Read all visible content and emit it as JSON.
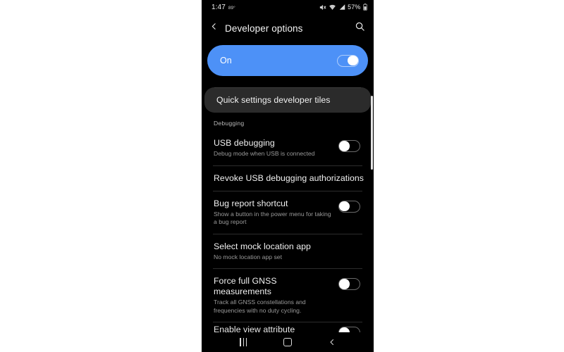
{
  "status_bar": {
    "time": "1:47",
    "temperature": "89°",
    "battery_percent": "57%",
    "icons": [
      "mute-icon",
      "wifi-icon",
      "signal-icon",
      "battery-icon"
    ]
  },
  "action_bar": {
    "back_icon": "back-chevron-icon",
    "title": "Developer options",
    "search_icon": "search-icon"
  },
  "master_switch": {
    "label": "On",
    "state": "on"
  },
  "colors": {
    "accent": "#4d91f7",
    "screen_background": "#000000",
    "highlight_card": "#2b2b2b",
    "primary_text": "#f1f1f1",
    "secondary_text": "#9a9a9a",
    "page_background": "#ffffff"
  },
  "list": {
    "highlighted_item": {
      "title": "Quick settings developer tiles",
      "subtitle": "",
      "toggle": null
    },
    "section_header": "Debugging",
    "items": [
      {
        "title": "USB debugging",
        "subtitle": "Debug mode when USB is connected",
        "toggle": "off"
      },
      {
        "title": "Revoke USB debugging authorizations",
        "subtitle": "",
        "toggle": null
      },
      {
        "title": "Bug report shortcut",
        "subtitle": "Show a button in the power menu for taking a bug report",
        "toggle": "off"
      },
      {
        "title": "Select mock location app",
        "subtitle": "No mock location app set",
        "toggle": null
      },
      {
        "title": "Force full GNSS measurements",
        "subtitle": "Track all GNSS constellations and frequencies with no duty cycling.",
        "toggle": "off"
      },
      {
        "title": "Enable view attribute inspection",
        "subtitle": "",
        "toggle": "off"
      }
    ]
  },
  "nav_bar": {
    "recents_label": "recents-button",
    "home_label": "home-button",
    "back_label": "back-button"
  }
}
